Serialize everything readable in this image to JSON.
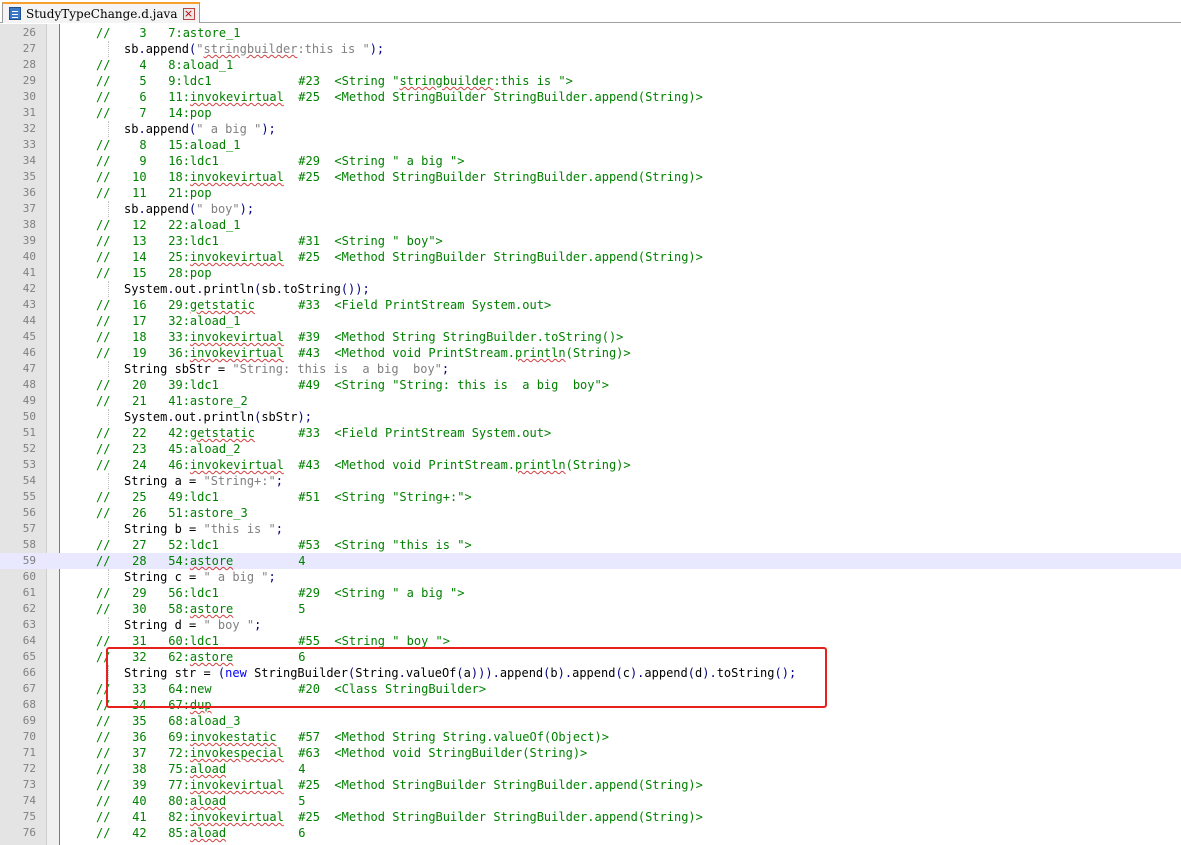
{
  "tab": {
    "label": "StudyTypeChange.d.java",
    "close": "×"
  },
  "lines": [
    {
      "n": "26",
      "kind": "bc",
      "idx": "3",
      "op": "7:astore_1",
      "ref": "",
      "cmt": ""
    },
    {
      "n": "27",
      "kind": "src",
      "code": "sb.append(\"stringbuilder:this is \");"
    },
    {
      "n": "28",
      "kind": "bc",
      "idx": "4",
      "op": "8:aload_1",
      "ref": "",
      "cmt": ""
    },
    {
      "n": "29",
      "kind": "bc",
      "idx": "5",
      "op": "9:ldc1",
      "ref": "#23",
      "cmt": "<String \"stringbuilder:this is \">"
    },
    {
      "n": "30",
      "kind": "bc",
      "idx": "6",
      "op": "11:invokevirtual",
      "ref": "#25",
      "cmt": "<Method StringBuilder StringBuilder.append(String)>"
    },
    {
      "n": "31",
      "kind": "bc",
      "idx": "7",
      "op": "14:pop",
      "ref": "",
      "cmt": ""
    },
    {
      "n": "32",
      "kind": "src",
      "code": "sb.append(\" a big \");"
    },
    {
      "n": "33",
      "kind": "bc",
      "idx": "8",
      "op": "15:aload_1",
      "ref": "",
      "cmt": ""
    },
    {
      "n": "34",
      "kind": "bc",
      "idx": "9",
      "op": "16:ldc1",
      "ref": "#29",
      "cmt": "<String \" a big \">"
    },
    {
      "n": "35",
      "kind": "bc",
      "idx": "10",
      "op": "18:invokevirtual",
      "ref": "#25",
      "cmt": "<Method StringBuilder StringBuilder.append(String)>"
    },
    {
      "n": "36",
      "kind": "bc",
      "idx": "11",
      "op": "21:pop",
      "ref": "",
      "cmt": ""
    },
    {
      "n": "37",
      "kind": "src",
      "code": "sb.append(\" boy\");"
    },
    {
      "n": "38",
      "kind": "bc",
      "idx": "12",
      "op": "22:aload_1",
      "ref": "",
      "cmt": ""
    },
    {
      "n": "39",
      "kind": "bc",
      "idx": "13",
      "op": "23:ldc1",
      "ref": "#31",
      "cmt": "<String \" boy\">"
    },
    {
      "n": "40",
      "kind": "bc",
      "idx": "14",
      "op": "25:invokevirtual",
      "ref": "#25",
      "cmt": "<Method StringBuilder StringBuilder.append(String)>"
    },
    {
      "n": "41",
      "kind": "bc",
      "idx": "15",
      "op": "28:pop",
      "ref": "",
      "cmt": ""
    },
    {
      "n": "42",
      "kind": "src",
      "code": "System.out.println(sb.toString());"
    },
    {
      "n": "43",
      "kind": "bc",
      "idx": "16",
      "op": "29:getstatic",
      "ref": "#33",
      "cmt": "<Field PrintStream System.out>"
    },
    {
      "n": "44",
      "kind": "bc",
      "idx": "17",
      "op": "32:aload_1",
      "ref": "",
      "cmt": ""
    },
    {
      "n": "45",
      "kind": "bc",
      "idx": "18",
      "op": "33:invokevirtual",
      "ref": "#39",
      "cmt": "<Method String StringBuilder.toString()>"
    },
    {
      "n": "46",
      "kind": "bc",
      "idx": "19",
      "op": "36:invokevirtual",
      "ref": "#43",
      "cmt": "<Method void PrintStream.println(String)>"
    },
    {
      "n": "47",
      "kind": "src",
      "code": "String sbStr = \"String: this is  a big  boy\";"
    },
    {
      "n": "48",
      "kind": "bc",
      "idx": "20",
      "op": "39:ldc1",
      "ref": "#49",
      "cmt": "<String \"String: this is  a big  boy\">"
    },
    {
      "n": "49",
      "kind": "bc",
      "idx": "21",
      "op": "41:astore_2",
      "ref": "",
      "cmt": ""
    },
    {
      "n": "50",
      "kind": "src",
      "code": "System.out.println(sbStr);"
    },
    {
      "n": "51",
      "kind": "bc",
      "idx": "22",
      "op": "42:getstatic",
      "ref": "#33",
      "cmt": "<Field PrintStream System.out>"
    },
    {
      "n": "52",
      "kind": "bc",
      "idx": "23",
      "op": "45:aload_2",
      "ref": "",
      "cmt": ""
    },
    {
      "n": "53",
      "kind": "bc",
      "idx": "24",
      "op": "46:invokevirtual",
      "ref": "#43",
      "cmt": "<Method void PrintStream.println(String)>"
    },
    {
      "n": "54",
      "kind": "src",
      "code": "String a = \"String+:\";"
    },
    {
      "n": "55",
      "kind": "bc",
      "idx": "25",
      "op": "49:ldc1",
      "ref": "#51",
      "cmt": "<String \"String+:\">"
    },
    {
      "n": "56",
      "kind": "bc",
      "idx": "26",
      "op": "51:astore_3",
      "ref": "",
      "cmt": ""
    },
    {
      "n": "57",
      "kind": "src",
      "code": "String b = \"this is \";"
    },
    {
      "n": "58",
      "kind": "bc",
      "idx": "27",
      "op": "52:ldc1",
      "ref": "#53",
      "cmt": "<String \"this is \">"
    },
    {
      "n": "59",
      "kind": "bc",
      "idx": "28",
      "op": "54:astore",
      "ref": "4",
      "cmt": "",
      "current": true
    },
    {
      "n": "60",
      "kind": "src",
      "code": "String c = \" a big \";"
    },
    {
      "n": "61",
      "kind": "bc",
      "idx": "29",
      "op": "56:ldc1",
      "ref": "#29",
      "cmt": "<String \" a big \">"
    },
    {
      "n": "62",
      "kind": "bc",
      "idx": "30",
      "op": "58:astore",
      "ref": "5",
      "cmt": ""
    },
    {
      "n": "63",
      "kind": "src",
      "code": "String d = \" boy \";"
    },
    {
      "n": "64",
      "kind": "bc",
      "idx": "31",
      "op": "60:ldc1",
      "ref": "#55",
      "cmt": "<String \" boy \">"
    },
    {
      "n": "65",
      "kind": "bc",
      "idx": "32",
      "op": "62:astore",
      "ref": "6",
      "cmt": ""
    },
    {
      "n": "66",
      "kind": "src",
      "code": "String str = (new StringBuilder(String.valueOf(a))).append(b).append(c).append(d).toString();"
    },
    {
      "n": "67",
      "kind": "bc",
      "idx": "33",
      "op": "64:new",
      "ref": "#20",
      "cmt": "<Class StringBuilder>"
    },
    {
      "n": "68",
      "kind": "bc",
      "idx": "34",
      "op": "67:dup",
      "ref": "",
      "cmt": ""
    },
    {
      "n": "69",
      "kind": "bc",
      "idx": "35",
      "op": "68:aload_3",
      "ref": "",
      "cmt": ""
    },
    {
      "n": "70",
      "kind": "bc",
      "idx": "36",
      "op": "69:invokestatic",
      "ref": "#57",
      "cmt": "<Method String String.valueOf(Object)>"
    },
    {
      "n": "71",
      "kind": "bc",
      "idx": "37",
      "op": "72:invokespecial",
      "ref": "#63",
      "cmt": "<Method void StringBuilder(String)>"
    },
    {
      "n": "72",
      "kind": "bc",
      "idx": "38",
      "op": "75:aload",
      "ref": "4",
      "cmt": ""
    },
    {
      "n": "73",
      "kind": "bc",
      "idx": "39",
      "op": "77:invokevirtual",
      "ref": "#25",
      "cmt": "<Method StringBuilder StringBuilder.append(String)>"
    },
    {
      "n": "74",
      "kind": "bc",
      "idx": "40",
      "op": "80:aload",
      "ref": "5",
      "cmt": ""
    },
    {
      "n": "75",
      "kind": "bc",
      "idx": "41",
      "op": "82:invokevirtual",
      "ref": "#25",
      "cmt": "<Method StringBuilder StringBuilder.append(String)>"
    },
    {
      "n": "76",
      "kind": "bc",
      "idx": "42",
      "op": "85:aload",
      "ref": "6",
      "cmt": ""
    }
  ],
  "colors": {
    "comment": "#008000",
    "string": "#808080",
    "keyword": "#0000ff",
    "highlight_box": "#e8201c"
  }
}
